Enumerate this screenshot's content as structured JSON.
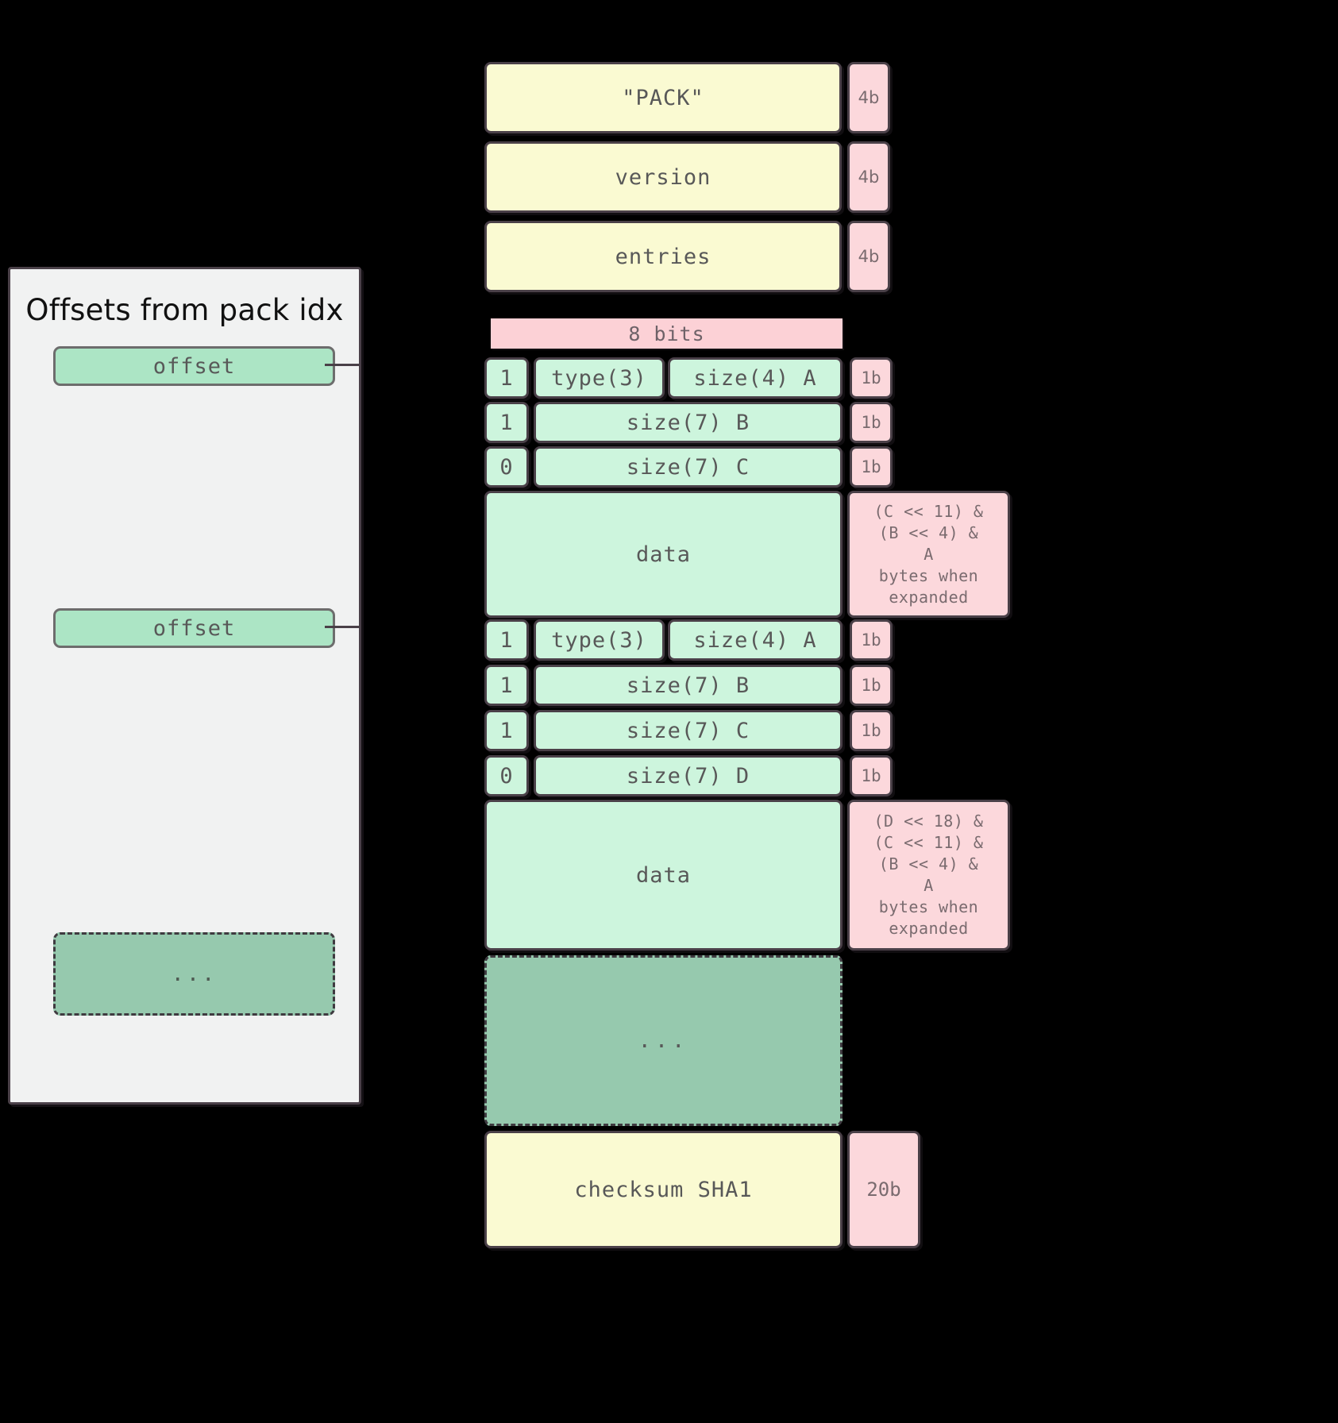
{
  "left_panel": {
    "title": "Offsets from pack idx",
    "offsets": [
      {
        "label": "offset"
      },
      {
        "label": "offset"
      }
    ],
    "ellipsis": "..."
  },
  "pack_file": {
    "header_rows": [
      {
        "label": "\"PACK\"",
        "size": "4b"
      },
      {
        "label": "version",
        "size": "4b"
      },
      {
        "label": "entries",
        "size": "4b"
      }
    ],
    "bits_bar": "8 bits",
    "object_1": {
      "bitfields": [
        {
          "flag": "1",
          "fields": [
            "type(3)",
            "size(4) A"
          ],
          "size": "1b"
        },
        {
          "flag": "1",
          "fields": [
            "size(7) B"
          ],
          "size": "1b"
        },
        {
          "flag": "0",
          "fields": [
            "size(7) C"
          ],
          "size": "1b"
        }
      ],
      "data_label": "data",
      "annotation": "(C << 11) &\n(B << 4) &\nA\nbytes when\nexpanded"
    },
    "object_2": {
      "bitfields": [
        {
          "flag": "1",
          "fields": [
            "type(3)",
            "size(4) A"
          ],
          "size": "1b"
        },
        {
          "flag": "1",
          "fields": [
            "size(7) B"
          ],
          "size": "1b"
        },
        {
          "flag": "1",
          "fields": [
            "size(7) C"
          ],
          "size": "1b"
        },
        {
          "flag": "0",
          "fields": [
            "size(7) D"
          ],
          "size": "1b"
        }
      ],
      "data_label": "data",
      "annotation": "(D << 18) &\n(C << 11) &\n(B << 4) &\nA\nbytes when\nexpanded"
    },
    "ellipsis": "...",
    "checksum": {
      "label": "checksum SHA1",
      "size": "20b"
    }
  },
  "colors": {
    "yellow": "#fafad2",
    "green": "#cdf5dd",
    "pink": "#fcd8dc",
    "dark_green": "#96c9ae",
    "panel_bg": "#f1f2f2",
    "stroke": "#4a4048"
  }
}
